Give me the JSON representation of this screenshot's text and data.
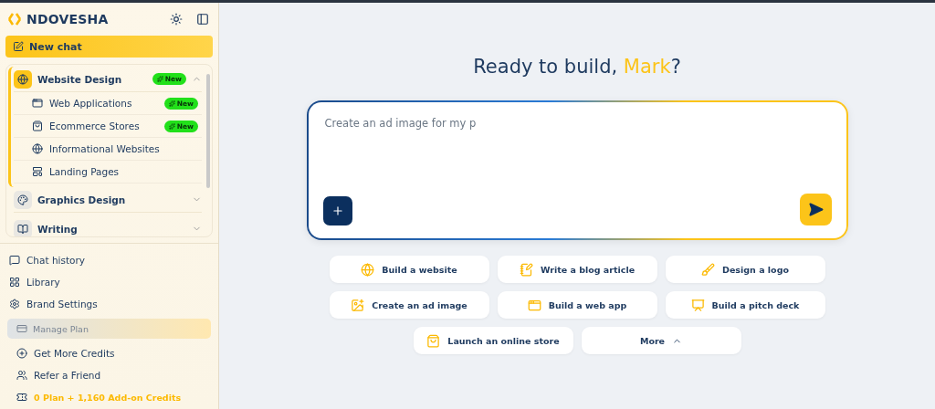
{
  "brand": {
    "name": "NDOVESHA"
  },
  "new_chat": {
    "label": "New chat"
  },
  "categories": [
    {
      "label": "Website Design",
      "expanded": true,
      "badge": "New",
      "children": [
        {
          "label": "Web Applications",
          "badge": "New"
        },
        {
          "label": "Ecommerce Stores",
          "badge": "New"
        },
        {
          "label": "Informational Websites"
        },
        {
          "label": "Landing Pages"
        }
      ]
    },
    {
      "label": "Graphics Design",
      "expanded": false
    },
    {
      "label": "Writing",
      "expanded": false
    }
  ],
  "menu": [
    {
      "label": "Chat history"
    },
    {
      "label": "Library"
    },
    {
      "label": "Brand Settings"
    }
  ],
  "manage_plan": {
    "label": "Manage Plan",
    "disabled": true
  },
  "account": [
    {
      "label": "Get More Credits",
      "kind": "link"
    },
    {
      "label": "Refer a Friend",
      "kind": "link"
    },
    {
      "label": "0 Plan + 1,160 Add-on Credits",
      "kind": "credits"
    }
  ],
  "greeting": {
    "text": "Ready to build, ",
    "name": "Mark",
    "end": "?"
  },
  "prompt": {
    "placeholder": "Create an ad image for my p"
  },
  "suggestions": [
    {
      "label": "Build a website"
    },
    {
      "label": "Write a blog article"
    },
    {
      "label": "Design a logo"
    },
    {
      "label": "Create an ad image"
    },
    {
      "label": "Build a web app"
    },
    {
      "label": "Build a pitch deck"
    },
    {
      "label": "Launch an online store"
    },
    {
      "label": "More",
      "kind": "more"
    }
  ]
}
